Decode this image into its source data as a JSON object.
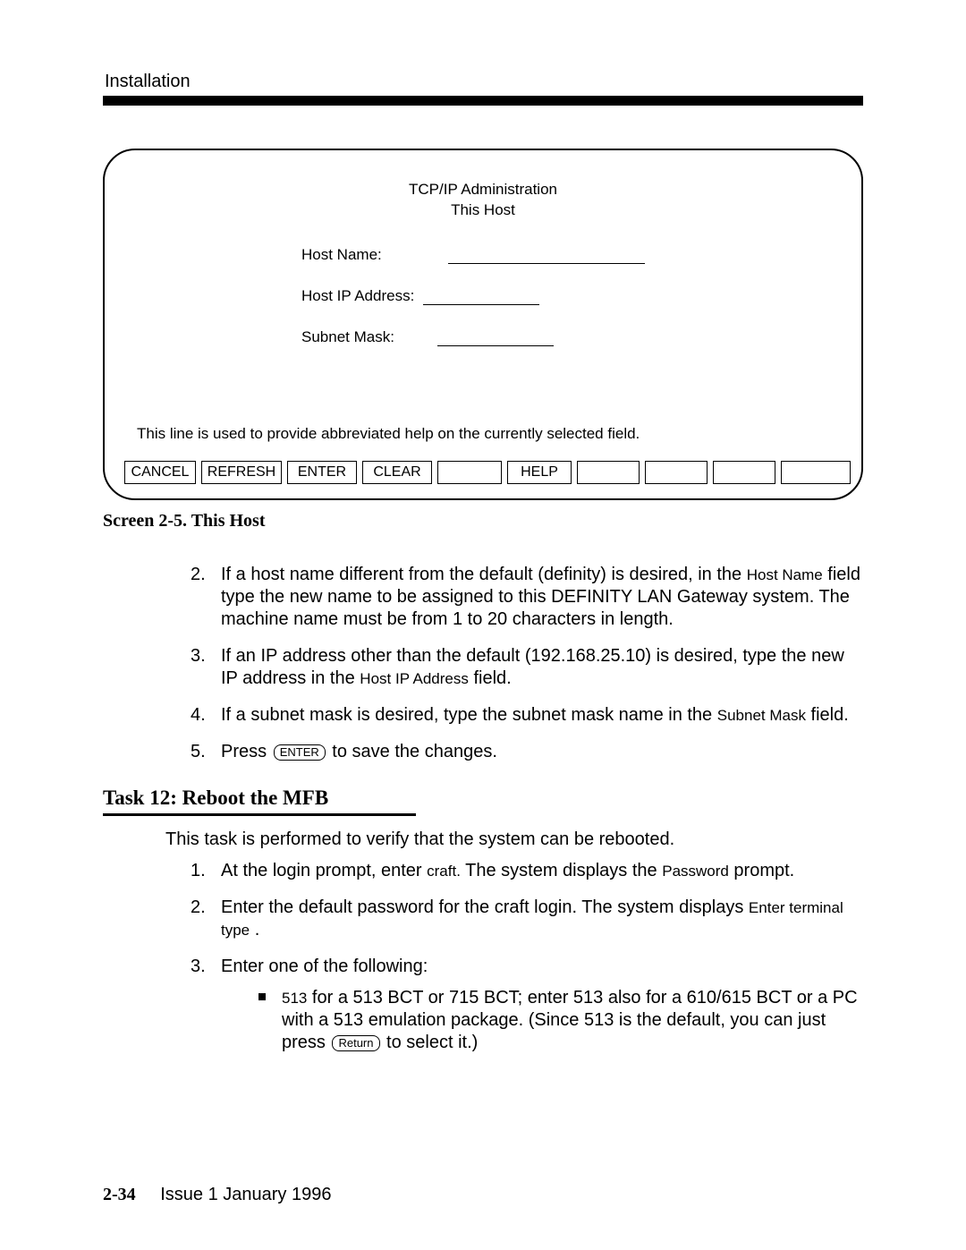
{
  "header": {
    "section": "Installation"
  },
  "screen": {
    "title": "TCP/IP Administration",
    "subtitle": "This Host",
    "fields": {
      "host_name_label": "Host Name:",
      "host_ip_label": "Host IP Address:",
      "subnet_label": "Subnet Mask:"
    },
    "help_line": "This line is used to provide abbreviated help on the currently selected field.",
    "buttons": {
      "cancel": "CANCEL",
      "refresh": "REFRESH",
      "enter": "ENTER",
      "clear": "CLEAR",
      "help": "HELP"
    }
  },
  "caption": "Screen 2-5.  This Host",
  "steps_a": {
    "s2_num": "2.",
    "s2_a": "If a host name different from the default (definity) is desired, in the ",
    "s2_code": "Host Name",
    "s2_b": " field type the new name to be assigned to this DEFINITY LAN Gateway system. The machine name must be from 1 to 20 characters in length.",
    "s3_num": "3.",
    "s3_a": "If an IP address other than the default (192.168.25.10) is desired, type the new IP address in the ",
    "s3_code": "Host IP Address",
    "s3_b": " field.",
    "s4_num": "4.",
    "s4_a": "If a subnet mask is desired, type the subnet mask name in the ",
    "s4_code": "Subnet Mask",
    "s4_b": " field.",
    "s5_num": "5.",
    "s5_a": "Press ",
    "s5_key": "ENTER",
    "s5_b": " to save the changes."
  },
  "task": {
    "heading": "Task 12: Reboot the MFB",
    "intro": "This task is performed to verify that the system can be rebooted.",
    "s1_num": "1.",
    "s1_a": "At the login prompt, enter ",
    "s1_code1": "craft.",
    "s1_b": "   The system displays the ",
    "s1_code2": "Password",
    "s1_c": " prompt.",
    "s2_num": "2.",
    "s2_a": "Enter the default password for the craft login.  The system displays ",
    "s2_code": "Enter terminal type",
    "s2_b": " .",
    "s3_num": "3.",
    "s3_a": "Enter one of the following:",
    "bullet_code": "513",
    "bullet_a": " for a 513 BCT or 715 BCT; enter 513 also for a 610/615 BCT or a PC with a 513 emulation package. (Since 513 is the default, you can just press ",
    "bullet_key": "Return",
    "bullet_b": " to select it.)"
  },
  "footer": {
    "page": "2-34",
    "issue": "Issue 1  January 1996"
  }
}
